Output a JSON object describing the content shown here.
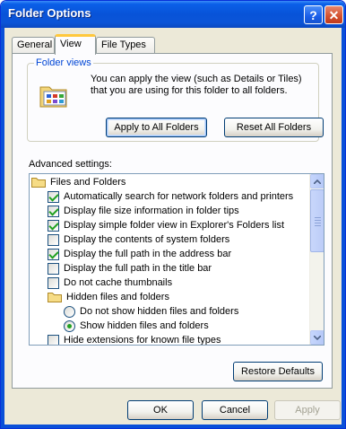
{
  "window": {
    "title": "Folder Options"
  },
  "titlebar": {
    "help_glyph": "?",
    "close_glyph": "✕"
  },
  "tabs": [
    {
      "label": "General",
      "selected": false
    },
    {
      "label": "View",
      "selected": true
    },
    {
      "label": "File Types",
      "selected": false
    }
  ],
  "folder_views": {
    "legend": "Folder views",
    "description": "You can apply the view (such as Details or Tiles) that you are using for this folder to all folders.",
    "apply_all_label": "Apply to All Folders",
    "reset_all_label": "Reset All Folders"
  },
  "advanced": {
    "label": "Advanced settings:",
    "items": [
      {
        "type": "folder",
        "label": "Files and Folders",
        "indent": 0
      },
      {
        "type": "checkbox",
        "checked": true,
        "label": "Automatically search for network folders and printers",
        "indent": 1
      },
      {
        "type": "checkbox",
        "checked": true,
        "label": "Display file size information in folder tips",
        "indent": 1
      },
      {
        "type": "checkbox",
        "checked": true,
        "label": "Display simple folder view in Explorer's Folders list",
        "indent": 1
      },
      {
        "type": "checkbox",
        "checked": false,
        "label": "Display the contents of system folders",
        "indent": 1
      },
      {
        "type": "checkbox",
        "checked": true,
        "label": "Display the full path in the address bar",
        "indent": 1
      },
      {
        "type": "checkbox",
        "checked": false,
        "label": "Display the full path in the title bar",
        "indent": 1
      },
      {
        "type": "checkbox",
        "checked": false,
        "label": "Do not cache thumbnails",
        "indent": 1
      },
      {
        "type": "folder",
        "label": "Hidden files and folders",
        "indent": 1
      },
      {
        "type": "radio",
        "checked": false,
        "label": "Do not show hidden files and folders",
        "indent": 2
      },
      {
        "type": "radio",
        "checked": true,
        "label": "Show hidden files and folders",
        "indent": 2
      },
      {
        "type": "checkbox",
        "checked": false,
        "label": "Hide extensions for known file types",
        "indent": 1
      }
    ],
    "restore_label": "Restore Defaults"
  },
  "footer": {
    "ok_label": "OK",
    "cancel_label": "Cancel",
    "apply_label": "Apply"
  },
  "colors": {
    "title_bar": "#0853d8",
    "dialog_face": "#ece9d8",
    "group_legend": "#0046d5",
    "check_mark": "#21a121"
  }
}
